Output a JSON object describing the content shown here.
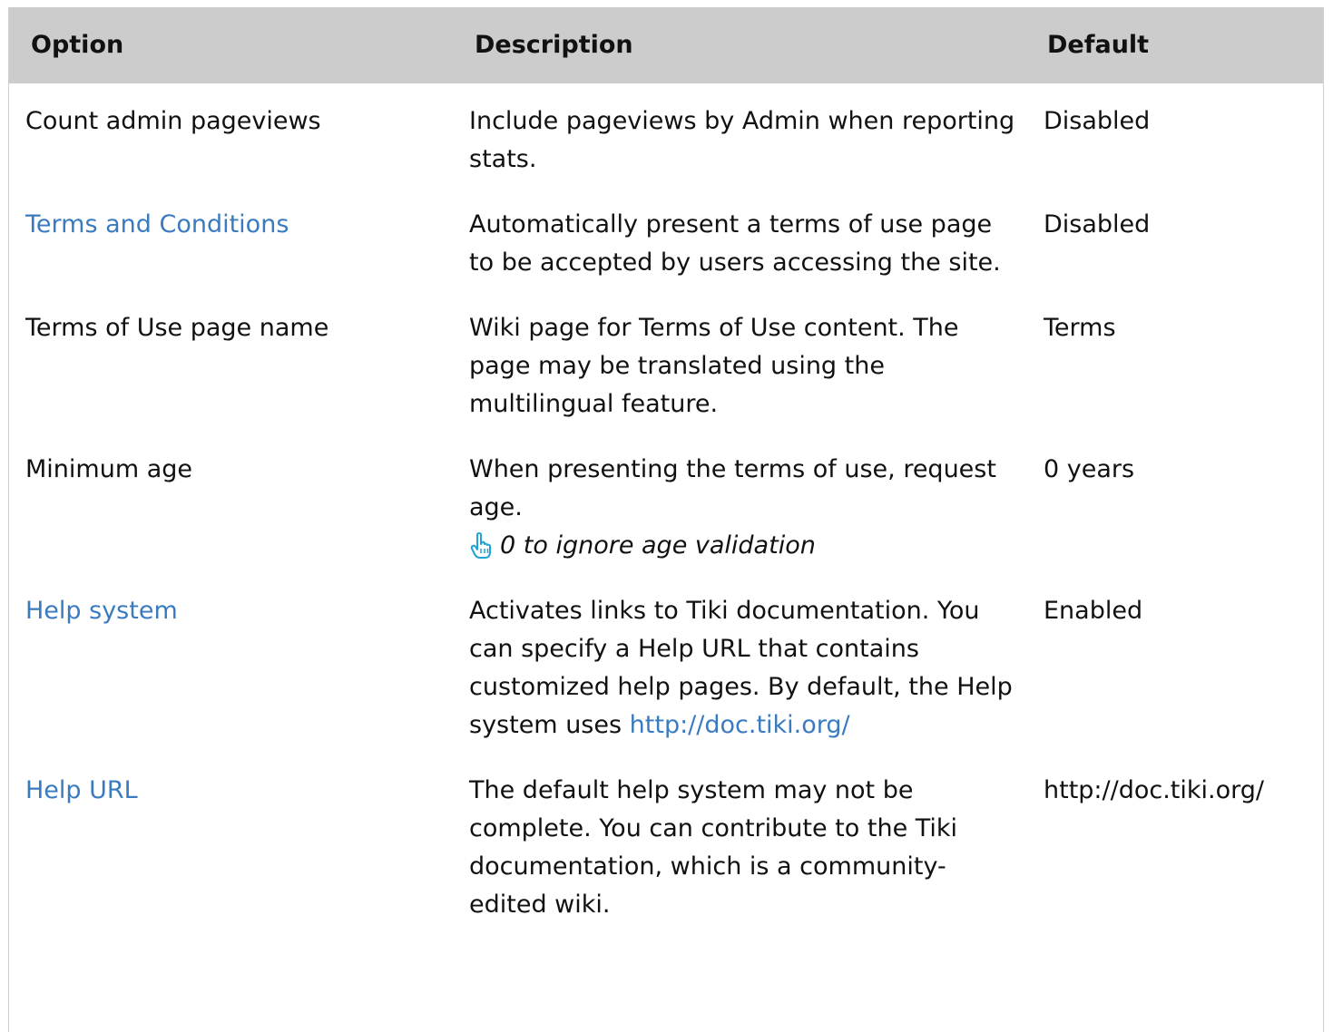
{
  "table": {
    "headers": {
      "option": "Option",
      "description": "Description",
      "default": "Default"
    },
    "rows": [
      {
        "option": "Count admin pageviews",
        "option_is_link": false,
        "description": "Include pageviews by Admin when reporting stats.",
        "default": "Disabled"
      },
      {
        "option": "Terms and Conditions",
        "option_is_link": true,
        "description": "Automatically present a terms of use page to be accepted by users accessing the site.",
        "default": "Disabled"
      },
      {
        "option": "Terms of Use page name",
        "option_is_link": false,
        "description": "Wiki page for Terms of Use content. The page may be translated using the multilingual feature.",
        "default": "Terms"
      },
      {
        "option": "Minimum age",
        "option_is_link": false,
        "description": "When presenting the terms of use, request age.",
        "tip": "0 to ignore age validation",
        "tip_icon": "pointing-hand-icon",
        "default": "0 years"
      },
      {
        "option": "Help system",
        "option_is_link": true,
        "description": "Activates links to Tiki documentation. You can specify a Help URL that contains customized help pages. By default, the Help system uses",
        "description_link": "http://doc.tiki.org/",
        "default": "Enabled"
      },
      {
        "option": "Help URL",
        "option_is_link": true,
        "description": "The default help system may not be complete. You can contribute to the Tiki documentation, which is a community-edited wiki.",
        "default": "http://doc.tiki.org/"
      }
    ]
  },
  "colors": {
    "header_bg": "#cccccc",
    "link": "#3a7bbf",
    "icon": "#1fa3d8"
  }
}
